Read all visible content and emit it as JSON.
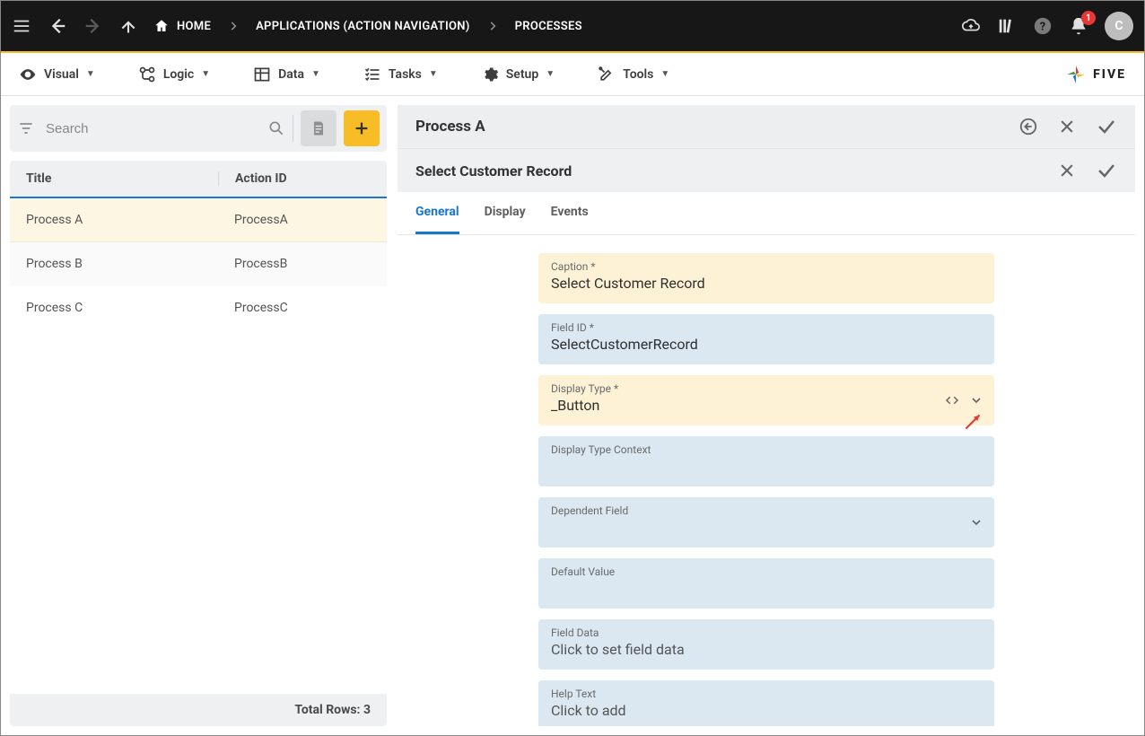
{
  "topbar": {
    "home_label": "HOME",
    "crumb_apps": "APPLICATIONS (ACTION NAVIGATION)",
    "crumb_processes": "PROCESSES",
    "badge_count": "1",
    "avatar_initial": "C"
  },
  "toolbar": {
    "visual": "Visual",
    "logic": "Logic",
    "data": "Data",
    "tasks": "Tasks",
    "setup": "Setup",
    "tools": "Tools",
    "brand": "FIVE"
  },
  "list": {
    "search_placeholder": "Search",
    "col_title": "Title",
    "col_action_id": "Action ID",
    "rows": [
      {
        "title": "Process A",
        "action_id": "ProcessA"
      },
      {
        "title": "Process B",
        "action_id": "ProcessB"
      },
      {
        "title": "Process C",
        "action_id": "ProcessC"
      }
    ],
    "status": "Total Rows: 3"
  },
  "detail": {
    "title": "Process A",
    "subtitle": "Select Customer Record",
    "tabs": {
      "general": "General",
      "display": "Display",
      "events": "Events"
    },
    "fields": {
      "caption_label": "Caption *",
      "caption_value": "Select Customer Record",
      "fieldid_label": "Field ID *",
      "fieldid_value": "SelectCustomerRecord",
      "displaytype_label": "Display Type *",
      "displaytype_value": "_Button",
      "displaytypectx_label": "Display Type Context",
      "displaytypectx_value": "",
      "dependent_label": "Dependent Field",
      "dependent_value": "",
      "default_label": "Default Value",
      "default_value": "",
      "fielddata_label": "Field Data",
      "fielddata_value": "Click to set field data",
      "helptext_label": "Help Text",
      "helptext_value": "Click to add"
    }
  }
}
